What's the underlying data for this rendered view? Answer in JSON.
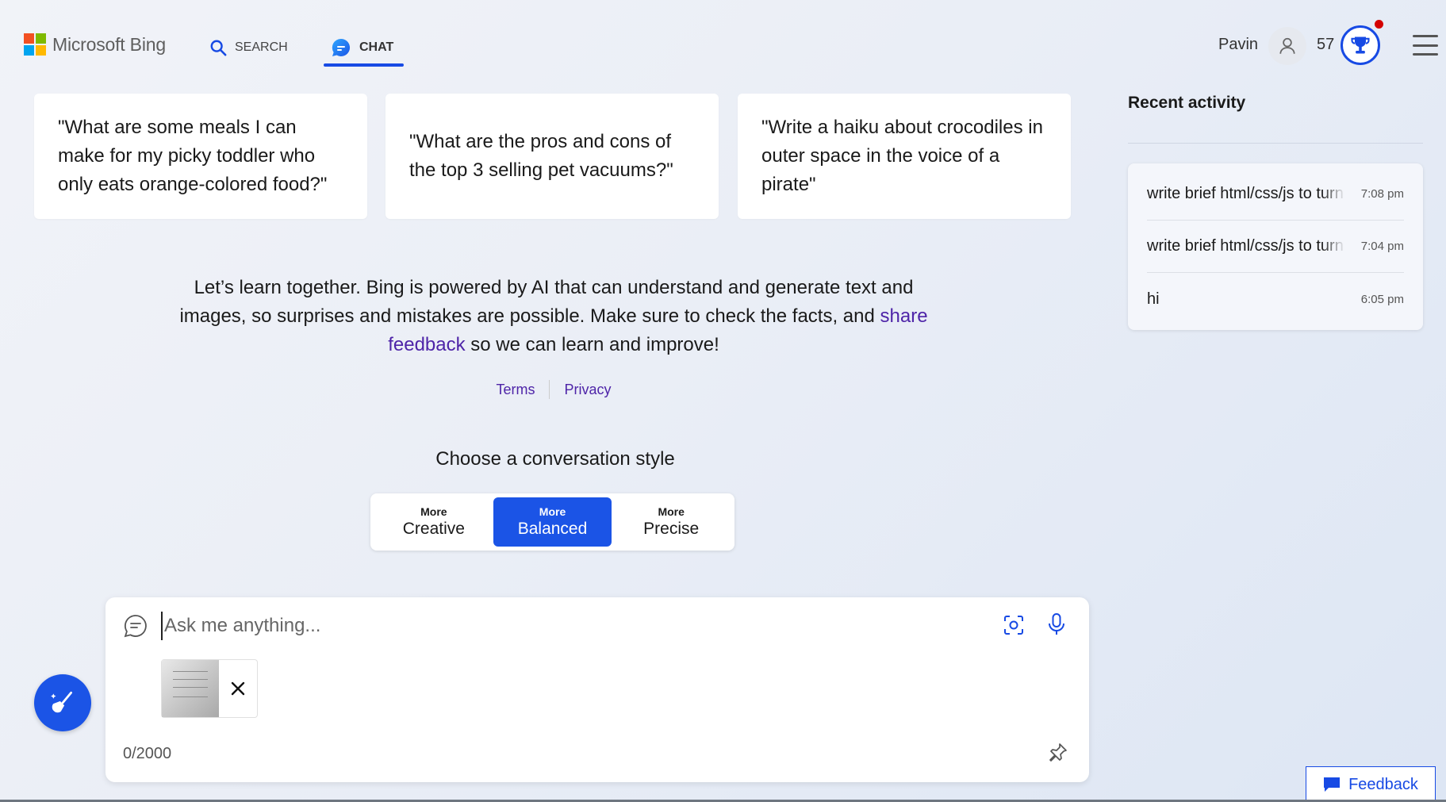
{
  "header": {
    "logo_text": "Microsoft Bing",
    "tabs": [
      {
        "label": "SEARCH",
        "icon": "search-icon"
      },
      {
        "label": "CHAT",
        "icon": "chat-bubble-icon",
        "active": true
      }
    ],
    "user_name": "Pavin",
    "reward_points": "57",
    "accent_color": "#174ae4"
  },
  "suggestions": [
    "\"What are some meals I can make for my picky toddler who only eats orange-colored food?\"",
    "\"What are the pros and cons of the top 3 selling pet vacuums?\"",
    "\"Write a haiku about crocodiles in outer space in the voice of a pirate\""
  ],
  "disclaimer": {
    "text_before": "Let’s learn together. Bing is powered by AI that can understand and generate text and images, so surprises and mistakes are possible. Make sure to check the facts, and ",
    "link": "share feedback",
    "text_after": " so we can learn and improve!"
  },
  "legal": {
    "terms": "Terms",
    "privacy": "Privacy"
  },
  "conversation_style": {
    "title": "Choose a conversation style",
    "options": [
      {
        "small": "More",
        "label": "Creative"
      },
      {
        "small": "More",
        "label": "Balanced",
        "selected": true
      },
      {
        "small": "More",
        "label": "Precise"
      }
    ]
  },
  "input": {
    "placeholder": "Ask me anything...",
    "value": "",
    "char_count": "0/2000"
  },
  "recent_activity": {
    "title": "Recent activity",
    "items": [
      {
        "text": "write brief html/css/js to turn",
        "time": "7:08 pm"
      },
      {
        "text": "write brief html/css/js to turn",
        "time": "7:04 pm"
      },
      {
        "text": "hi",
        "time": "6:05 pm"
      }
    ]
  },
  "feedback": {
    "label": "Feedback"
  }
}
